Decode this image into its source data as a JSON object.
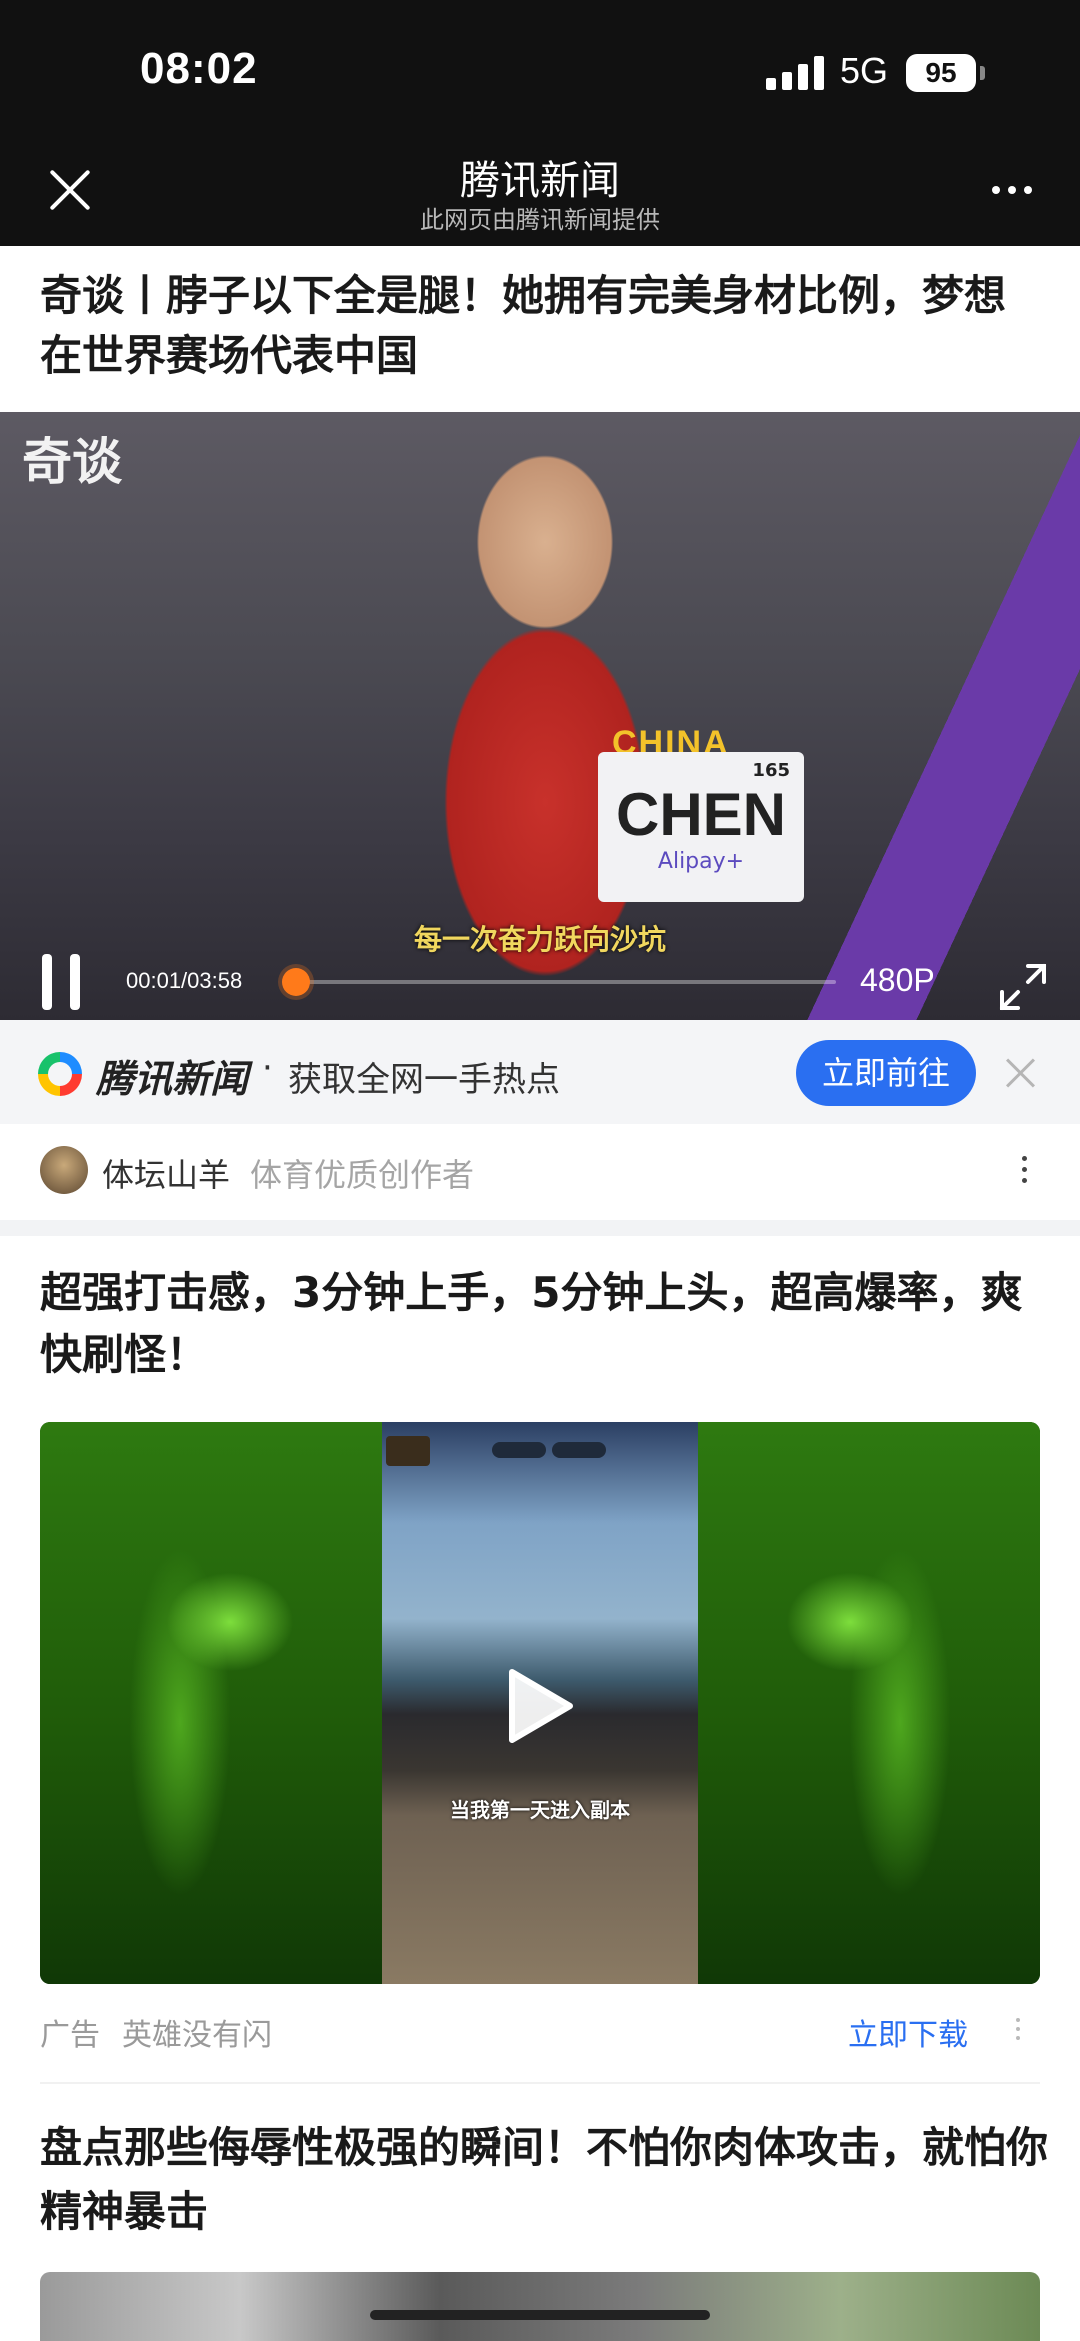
{
  "status_bar": {
    "time": "08:02",
    "network": "5G",
    "battery": "95"
  },
  "nav": {
    "title": "腾讯新闻",
    "subtitle": "此网页由腾讯新闻提供"
  },
  "article": {
    "headline": "奇谈丨脖子以下全是腿！她拥有完美身材比例，梦想在世界赛场代表中国",
    "video": {
      "watermark": "奇谈",
      "chest_text": "CHINA",
      "bib_name": "CHEN",
      "bib_number": "165",
      "bib_sponsor": "Alipay+",
      "subtitle": "每一次奋力跃向沙坑",
      "time": "00:01/03:58",
      "progress_fraction": 0.004,
      "quality": "480P"
    }
  },
  "app_banner": {
    "brand": "腾讯新闻",
    "separator": "·",
    "text": "获取全网一手热点",
    "button": "立即前往"
  },
  "author": {
    "name": "体坛山羊",
    "tag": "体育优质创作者"
  },
  "ad": {
    "title": "超强打击感，3分钟上手，5分钟上头，超高爆率，爽快刷怪！",
    "media_caption": "当我第一天进入副本",
    "label": "广告",
    "advertiser": "英雄没有闪",
    "download": "立即下载"
  },
  "next_article": {
    "headline": "盘点那些侮辱性极强的瞬间！不怕你肉体攻击，就怕你精神暴击"
  },
  "colors": {
    "accent": "#2a6ff1",
    "progress": "#ff7a1a",
    "topbar": "#111111"
  }
}
